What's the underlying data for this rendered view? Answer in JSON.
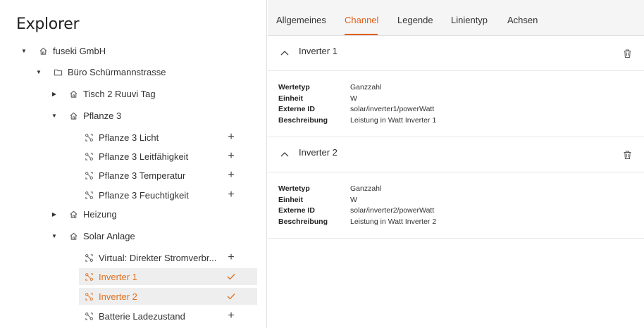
{
  "explorer": {
    "title": "Explorer",
    "tree": [
      {
        "label": "fuseki GmbH",
        "icon": "home-icon",
        "expand": "expanded"
      },
      {
        "label": "Büro Schürmannstrasse",
        "icon": "folder-icon",
        "expand": "expanded"
      },
      {
        "label": "Tisch 2 Ruuvi Tag",
        "icon": "home-icon",
        "expand": "collapsed"
      },
      {
        "label": "Pflanze 3",
        "icon": "home-icon",
        "expand": "expanded"
      },
      {
        "label": "Pflanze 3 Licht",
        "icon": "channel-icon",
        "action": "plus"
      },
      {
        "label": "Pflanze 3 Leitfähigkeit",
        "icon": "channel-icon",
        "action": "plus"
      },
      {
        "label": "Pflanze 3 Temperatur",
        "icon": "channel-icon",
        "action": "plus"
      },
      {
        "label": "Pflanze 3 Feuchtigkeit",
        "icon": "channel-icon",
        "action": "plus"
      },
      {
        "label": "Heizung",
        "icon": "home-icon",
        "expand": "collapsed"
      },
      {
        "label": "Solar Anlage",
        "icon": "home-icon",
        "expand": "expanded"
      },
      {
        "label": "Virtual: Direkter Stromverbr...",
        "icon": "channel-icon",
        "action": "plus"
      },
      {
        "label": "Inverter 1",
        "icon": "channel-icon",
        "action": "check",
        "selected": true
      },
      {
        "label": "Inverter 2",
        "icon": "channel-icon",
        "action": "check",
        "selected": true
      },
      {
        "label": "Batterie Ladezustand",
        "icon": "channel-icon",
        "action": "plus"
      }
    ],
    "plus_symbol": "+"
  },
  "tabs": [
    {
      "label": "Allgemeines"
    },
    {
      "label": "Channel",
      "active": true
    },
    {
      "label": "Legende"
    },
    {
      "label": "Linientyp"
    },
    {
      "label": "Achsen"
    }
  ],
  "channels": [
    {
      "title": "Inverter 1",
      "props": [
        {
          "key": "Wertetyp",
          "value": "Ganzzahl"
        },
        {
          "key": "Einheit",
          "value": "W"
        },
        {
          "key": "Externe ID",
          "value": "solar/inverter1/powerWatt"
        },
        {
          "key": "Beschreibung",
          "value": "Leistung in Watt Inverter 1"
        }
      ]
    },
    {
      "title": "Inverter 2",
      "props": [
        {
          "key": "Wertetyp",
          "value": "Ganzzahl"
        },
        {
          "key": "Einheit",
          "value": "W"
        },
        {
          "key": "Externe ID",
          "value": "solar/inverter2/powerWatt"
        },
        {
          "key": "Beschreibung",
          "value": "Leistung in Watt Inverter 2"
        }
      ]
    }
  ],
  "colors": {
    "accent": "#e0601c",
    "selected_bg": "#eeeeee",
    "tab_bg": "#f5f5f5"
  }
}
